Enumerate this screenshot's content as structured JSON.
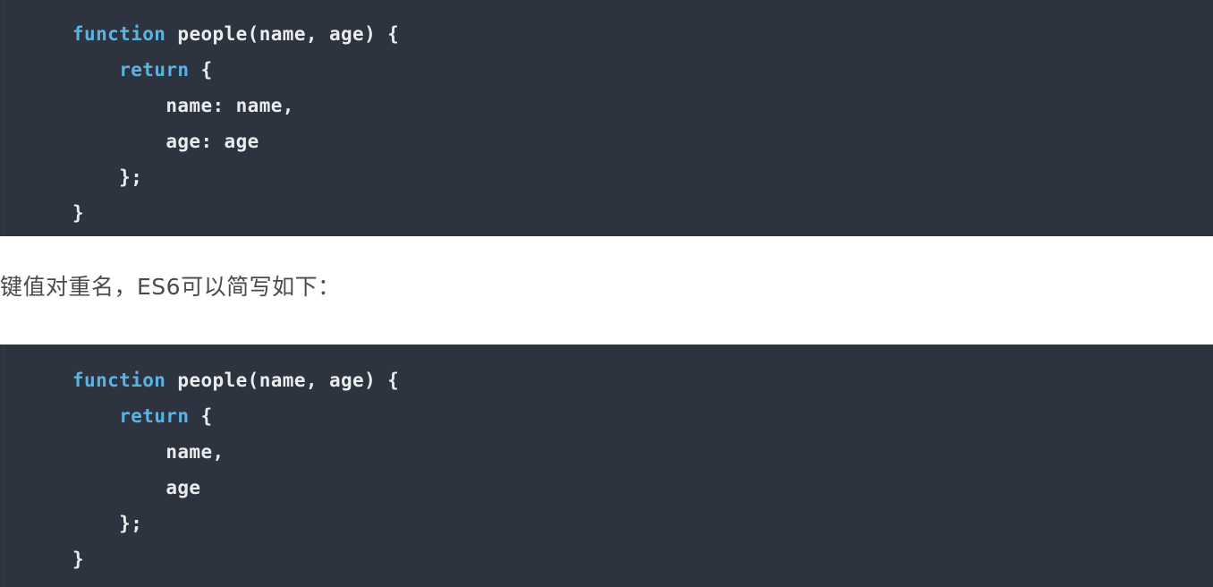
{
  "theme": {
    "code_background": "#2d333f",
    "page_background": "#ffffff",
    "keyword_color": "#5cb3e0",
    "code_text_color": "#e9ecef",
    "prose_text_color": "#4b4b4b"
  },
  "code_block_1": {
    "language": "javascript",
    "lines": [
      [
        {
          "t": "function",
          "c": "keyword"
        },
        {
          "t": " people(name, age) {",
          "c": "plain"
        }
      ],
      [
        {
          "t": "    ",
          "c": "plain"
        },
        {
          "t": "return",
          "c": "keyword"
        },
        {
          "t": " {",
          "c": "plain"
        }
      ],
      [
        {
          "t": "        name: name,",
          "c": "plain"
        }
      ],
      [
        {
          "t": "        age: age",
          "c": "plain"
        }
      ],
      [
        {
          "t": "    };",
          "c": "plain"
        }
      ],
      [
        {
          "t": "}",
          "c": "plain"
        }
      ]
    ]
  },
  "prose": {
    "text": "键值对重名，ES6可以简写如下："
  },
  "code_block_2": {
    "language": "javascript",
    "lines": [
      [
        {
          "t": "function",
          "c": "keyword"
        },
        {
          "t": " people(name, age) {",
          "c": "plain"
        }
      ],
      [
        {
          "t": "    ",
          "c": "plain"
        },
        {
          "t": "return",
          "c": "keyword"
        },
        {
          "t": " {",
          "c": "plain"
        }
      ],
      [
        {
          "t": "        name,",
          "c": "plain"
        }
      ],
      [
        {
          "t": "        age",
          "c": "plain"
        }
      ],
      [
        {
          "t": "    };",
          "c": "plain"
        }
      ],
      [
        {
          "t": "}",
          "c": "plain"
        }
      ]
    ]
  }
}
